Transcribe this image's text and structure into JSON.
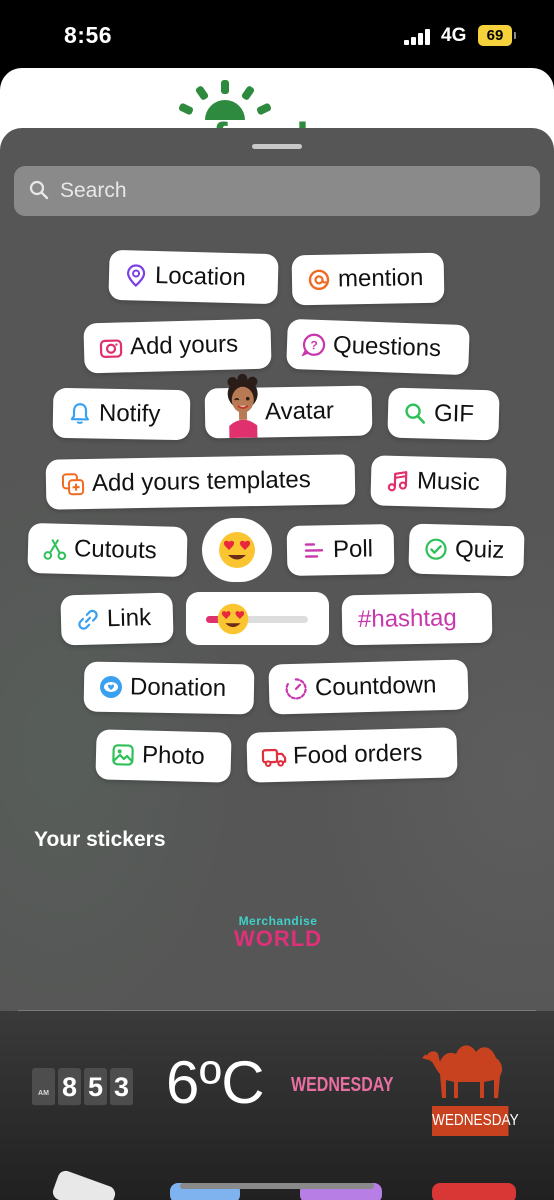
{
  "status": {
    "time": "8:56",
    "network": "4G",
    "battery": "69"
  },
  "background_page": {
    "brand": "gofundme"
  },
  "search": {
    "placeholder": "Search"
  },
  "stickers": {
    "location": "Location",
    "mention": "mention",
    "add_yours": "Add yours",
    "questions": "Questions",
    "notify": "Notify",
    "avatar": "Avatar",
    "gif": "GIF",
    "add_yours_templates": "Add yours templates",
    "music": "Music",
    "cutouts": "Cutouts",
    "poll": "Poll",
    "quiz": "Quiz",
    "link": "Link",
    "hashtag": "#hashtag",
    "donation": "Donation",
    "countdown": "Countdown",
    "photo": "Photo",
    "food_orders": "Food orders"
  },
  "your_stickers": {
    "title": "Your stickers",
    "merch_line1": "Merchandise",
    "merch_line2": "WORLD"
  },
  "widgets": {
    "clock_am": "AM",
    "clock_digits": [
      "8",
      "5",
      "3"
    ],
    "temperature": "6ºC",
    "weekday": "WEDNESDAY",
    "camel_label": "WEDNESDAY"
  },
  "colors": {
    "sheet": "#565656",
    "location": "#7b3fe4",
    "mention": "#f06a22",
    "add_yours": "#e0306e",
    "questions": "#c837ab",
    "notify": "#3aa0f0",
    "gif": "#2fc05a",
    "music": "#e0306e",
    "cutouts": "#2fc05a",
    "poll": "#c837ab",
    "quiz": "#2fc05a",
    "link": "#3aa0f0",
    "hashtag": "#c837ab",
    "donation": "#3aa0f0",
    "countdown": "#c837ab",
    "photo": "#2fc05a",
    "food_orders": "#e02f3f"
  }
}
